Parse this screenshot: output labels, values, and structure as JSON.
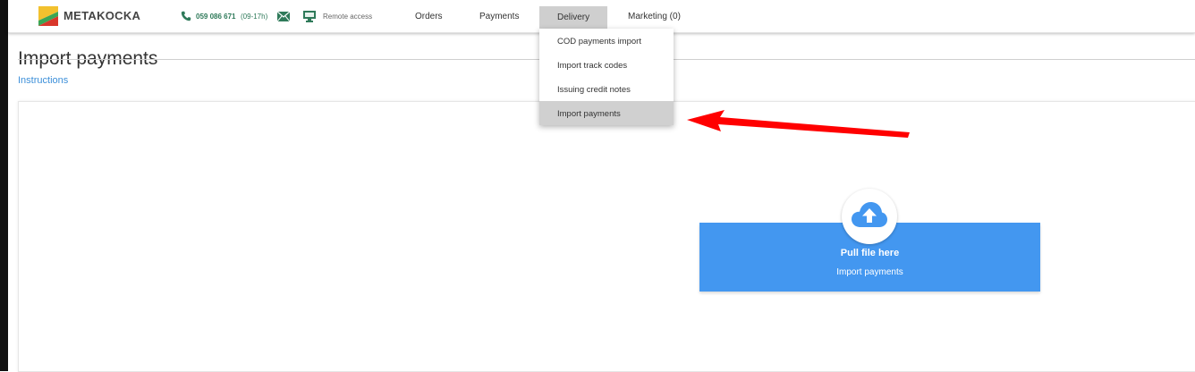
{
  "header": {
    "brand": "METAKOCKA",
    "phone": "059 086 671",
    "phone_hours": "(09-17h)",
    "remote_access": "Remote access",
    "nav": [
      "Orders",
      "Payments",
      "Delivery",
      "Marketing (0)"
    ],
    "active_nav": "Delivery"
  },
  "dropdown": {
    "items": [
      "COD payments import",
      "Import track codes",
      "Issuing credit notes",
      "Import payments"
    ],
    "highlighted": "Import payments"
  },
  "page": {
    "title": "Import payments",
    "instructions_link": "Instructions"
  },
  "dropzone": {
    "title": "Pull file here",
    "subtitle": "Import payments"
  },
  "icons": {
    "logo": "metakocka-logo",
    "phone": "phone-icon",
    "mail": "mail-icon",
    "monitor": "monitor-icon",
    "upload": "cloud-upload-icon",
    "annotation": "red-arrow-icon"
  },
  "colors": {
    "accent_blue": "#4397f0",
    "link_blue": "#3c8fd9",
    "phone_green": "#2f7a5a",
    "active_gray": "#cfcfcf",
    "arrow_red": "#ff0000"
  }
}
